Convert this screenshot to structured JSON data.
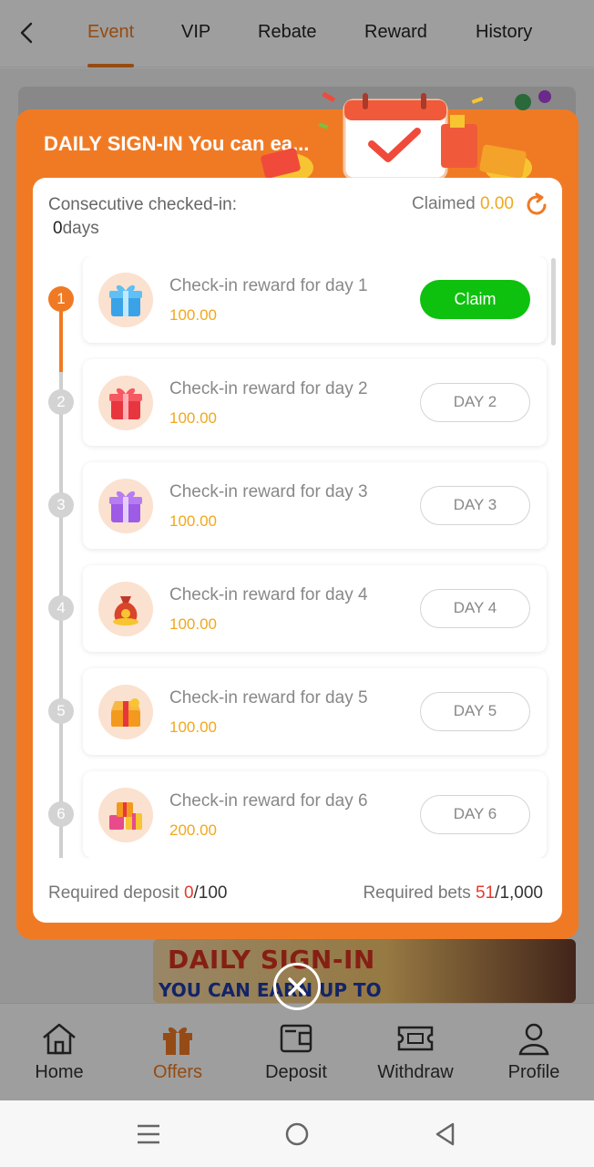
{
  "tabs": [
    {
      "label": "Event",
      "active": true
    },
    {
      "label": "VIP"
    },
    {
      "label": "Rebate"
    },
    {
      "label": "Reward"
    },
    {
      "label": "History"
    }
  ],
  "background_banner": {
    "line1": "DAILY SIGN-IN",
    "line2": "YOU CAN EARN UP TO"
  },
  "bottom_nav": [
    {
      "label": "Home",
      "icon": "home-icon"
    },
    {
      "label": "Offers",
      "icon": "gift-icon",
      "active": true
    },
    {
      "label": "Deposit",
      "icon": "wallet-icon"
    },
    {
      "label": "Withdraw",
      "icon": "ticket-icon"
    },
    {
      "label": "Profile",
      "icon": "profile-icon"
    }
  ],
  "modal": {
    "title": "DAILY SIGN-IN You can ea...",
    "consecutive_label": "Consecutive checked-in:",
    "consecutive_days": "0",
    "days_unit": "days",
    "claimed_label": "Claimed",
    "claimed_value": "0.00",
    "items": [
      {
        "step": "1",
        "title": "Check-in reward for day 1",
        "amount": "100.00",
        "button": "Claim",
        "claimable": true,
        "gift_color": "#3aa3e8",
        "icon": "blue-gift-icon"
      },
      {
        "step": "2",
        "title": "Check-in reward for day 2",
        "amount": "100.00",
        "button": "DAY 2",
        "gift_color": "#e8363f",
        "icon": "red-gift-icon"
      },
      {
        "step": "3",
        "title": "Check-in reward for day 3",
        "amount": "100.00",
        "button": "DAY 3",
        "gift_color": "#9d5be6",
        "icon": "purple-gift-icon"
      },
      {
        "step": "4",
        "title": "Check-in reward for day 4",
        "amount": "100.00",
        "button": "DAY 4",
        "gift_color": "#d9452a",
        "icon": "money-bag-icon"
      },
      {
        "step": "5",
        "title": "Check-in reward for day 5",
        "amount": "100.00",
        "button": "DAY 5",
        "gift_color": "#f39a1e",
        "icon": "treasure-box-icon"
      },
      {
        "step": "6",
        "title": "Check-in reward for day 6",
        "amount": "200.00",
        "button": "DAY 6",
        "gift_color": "#e84a8c",
        "icon": "gift-pile-icon"
      }
    ],
    "required_deposit_label": "Required deposit",
    "required_deposit_current": "0",
    "required_deposit_total": "/100",
    "required_bets_label": "Required bets",
    "required_bets_current": "51",
    "required_bets_total": "/1,000"
  },
  "colors": {
    "accent": "#f07a24",
    "claim_green": "#0fc10f",
    "amount_gold": "#f0a81e",
    "alert_red": "#e43a2e"
  }
}
